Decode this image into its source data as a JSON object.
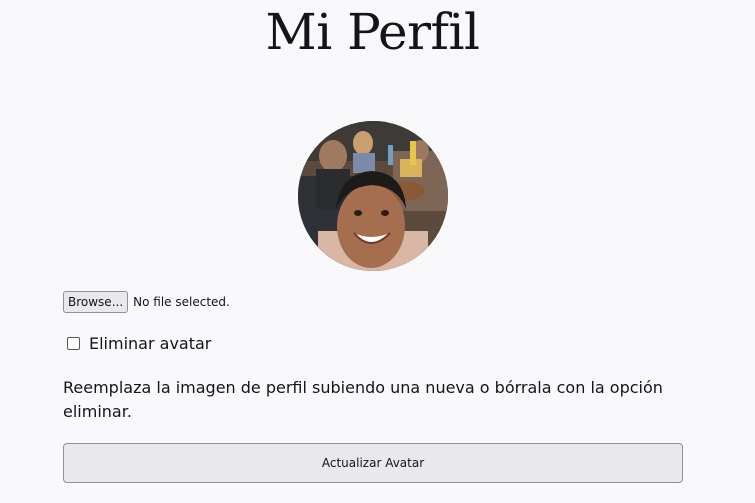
{
  "page": {
    "title": "Mi Perfil",
    "background": "#f9f9fb"
  },
  "avatar": {
    "icon": "profile-photo"
  },
  "upload": {
    "browse_label": "Browse...",
    "file_status": "No file selected."
  },
  "delete_option": {
    "label": "Eliminar avatar",
    "checked": false
  },
  "help_text": "Reemplaza la imagen de perfil subiendo una nueva o bórrala con la opción eliminar.",
  "submit": {
    "label": "Actualizar Avatar"
  }
}
